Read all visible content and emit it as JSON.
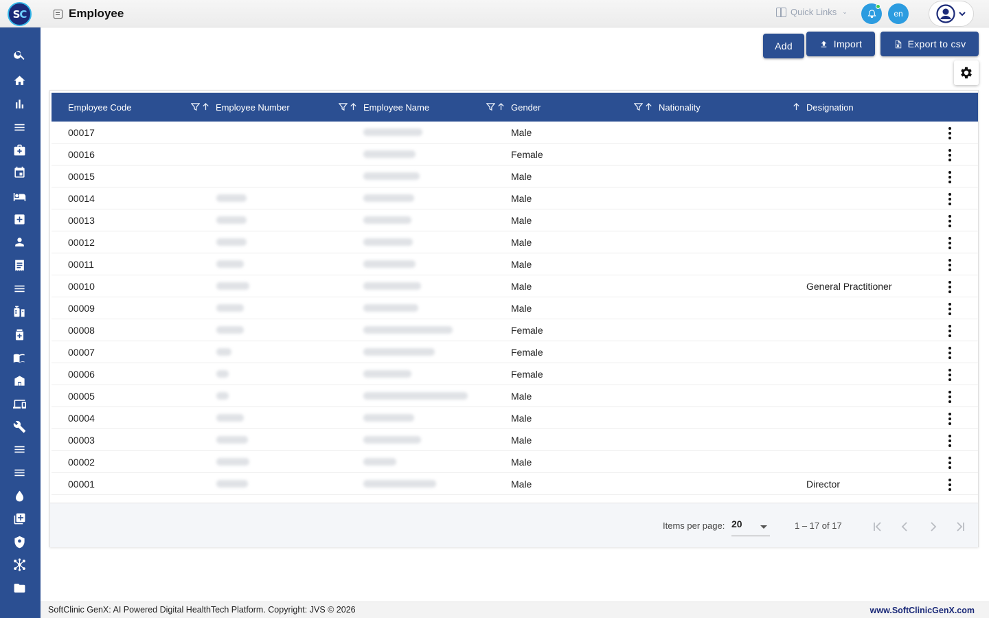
{
  "header": {
    "logo_text_s": "S",
    "logo_text_c": "C",
    "page_title": "Employee",
    "quick_links_label": "Quick Links",
    "language": "en"
  },
  "sidebar": {
    "items": [
      "search",
      "home",
      "analytics",
      "menu",
      "medical-bag",
      "calendar",
      "bed",
      "add-medical",
      "person",
      "receipt",
      "menu",
      "vaccine",
      "medical-box",
      "book",
      "store",
      "devices",
      "wrench",
      "menu",
      "menu",
      "blood-drop",
      "add-box",
      "shield",
      "network",
      "folder"
    ]
  },
  "toolbar": {
    "add_label": "Add",
    "import_label": "Import",
    "export_label": "Export to csv"
  },
  "table": {
    "columns": [
      "Employee Code",
      "Employee Number",
      "Employee Name",
      "Gender",
      "Nationality",
      "Designation"
    ],
    "rows": [
      {
        "code": "00017",
        "gender": "Male",
        "designation": ""
      },
      {
        "code": "00016",
        "gender": "Female",
        "designation": ""
      },
      {
        "code": "00015",
        "gender": "Male",
        "designation": ""
      },
      {
        "code": "00014",
        "gender": "Male",
        "designation": ""
      },
      {
        "code": "00013",
        "gender": "Male",
        "designation": ""
      },
      {
        "code": "00012",
        "gender": "Male",
        "designation": ""
      },
      {
        "code": "00011",
        "gender": "Male",
        "designation": ""
      },
      {
        "code": "00010",
        "gender": "Male",
        "designation": "General Practitioner"
      },
      {
        "code": "00009",
        "gender": "Male",
        "designation": ""
      },
      {
        "code": "00008",
        "gender": "Female",
        "designation": ""
      },
      {
        "code": "00007",
        "gender": "Female",
        "designation": ""
      },
      {
        "code": "00006",
        "gender": "Female",
        "designation": ""
      },
      {
        "code": "00005",
        "gender": "Male",
        "designation": ""
      },
      {
        "code": "00004",
        "gender": "Male",
        "designation": ""
      },
      {
        "code": "00003",
        "gender": "Male",
        "designation": ""
      },
      {
        "code": "00002",
        "gender": "Male",
        "designation": ""
      },
      {
        "code": "00001",
        "gender": "Male",
        "designation": "Director"
      }
    ]
  },
  "paginator": {
    "items_per_page_label": "Items per page:",
    "items_per_page_value": "20",
    "range_label": "1 – 17 of 17"
  },
  "footer": {
    "left": "SoftClinic GenX: AI Powered Digital HealthTech Platform. Copyright: JVS © 2026",
    "right": "www.SoftClinicGenX.com"
  },
  "colors": {
    "primary": "#2b4f92",
    "accent": "#2c9ce0",
    "online": "#3dcb53"
  }
}
